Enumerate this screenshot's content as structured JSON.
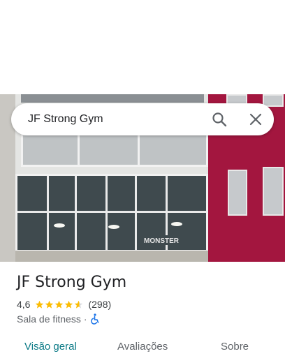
{
  "search": {
    "query": "JF Strong Gym",
    "search_icon": "search-icon",
    "close_icon": "close-icon"
  },
  "photo": {
    "sign_text": "MONSTER"
  },
  "place": {
    "name": "JF Strong Gym",
    "rating": "4,6",
    "stars_value": 4.6,
    "star_color": "#fbbc04",
    "review_count": "(298)",
    "category": "Sala de fitness",
    "separator": "·",
    "accessibility_icon": "wheelchair-icon",
    "accessibility_color": "#1a73e8"
  },
  "tabs": [
    {
      "label": "Visão geral",
      "active": true
    },
    {
      "label": "Avaliações",
      "active": false
    },
    {
      "label": "Sobre",
      "active": false
    }
  ],
  "colors": {
    "active_tab": "#0b7a86",
    "text_primary": "#202124",
    "text_secondary": "#5f6368"
  }
}
